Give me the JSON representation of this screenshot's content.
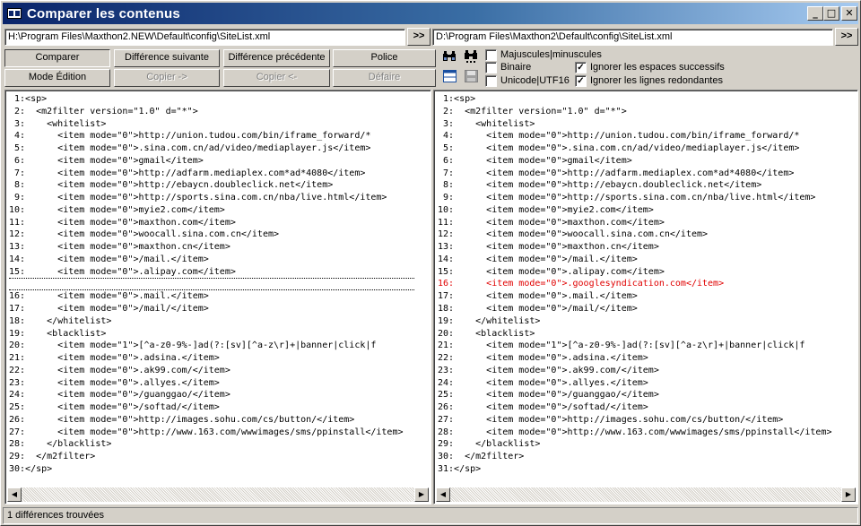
{
  "window": {
    "title": "Comparer les contenus",
    "buttons": {
      "minimize": "_",
      "maximize": "□",
      "close": "✕"
    }
  },
  "paths": {
    "left": "H:\\Program Files\\Maxthon2.NEW\\Default\\config\\SiteList.xml",
    "right": "D:\\Program Files\\Maxthon2\\Default\\config\\SiteList.xml",
    "browse_label": ">>"
  },
  "toolbar": {
    "compare": "Comparer",
    "next_diff": "Différence suivante",
    "prev_diff": "Différence précédente",
    "font": "Police",
    "edit_mode": "Mode Édition",
    "copy_right": "Copier ->",
    "copy_left": "Copier <-",
    "undo": "Défaire"
  },
  "options": {
    "case": {
      "label": "Majuscules|minuscules",
      "checked": false
    },
    "binary": {
      "label": "Binaire",
      "checked": false
    },
    "unicode": {
      "label": "Unicode|UTF16",
      "checked": false
    },
    "ignore_spaces": {
      "label": "Ignorer les espaces successifs",
      "checked": true
    },
    "ignore_lines": {
      "label": "Ignorer les lignes redondantes",
      "checked": true
    },
    "check_mark": "✓"
  },
  "left_lines": [
    " 1:<sp>",
    " 2:  <m2filter version=\"1.0\" d=\"*\">",
    " 3:    <whitelist>",
    " 4:      <item mode=\"0\">http://union.tudou.com/bin/iframe_forward/*",
    " 5:      <item mode=\"0\">.sina.com.cn/ad/video/mediaplayer.js</item>",
    " 6:      <item mode=\"0\">gmail</item>",
    " 7:      <item mode=\"0\">http://adfarm.mediaplex.com*ad*4080</item>",
    " 8:      <item mode=\"0\">http://ebaycn.doubleclick.net</item>",
    " 9:      <item mode=\"0\">http://sports.sina.com.cn/nba/live.html</item>",
    "10:      <item mode=\"0\">myie2.com</item>",
    "11:      <item mode=\"0\">maxthon.com</item>",
    "12:      <item mode=\"0\">woocall.sina.com.cn</item>",
    "13:      <item mode=\"0\">maxthon.cn</item>",
    "14:      <item mode=\"0\">/mail.</item>",
    "15:      <item mode=\"0\">.alipay.com</item>",
    "",
    "16:      <item mode=\"0\">.mail.</item>",
    "17:      <item mode=\"0\">/mail/</item>",
    "18:    </whitelist>",
    "19:    <blacklist>",
    "20:      <item mode=\"1\">[^a-z0-9%-]ad(?:[sv][^a-z\\r]+|banner|click|f",
    "21:      <item mode=\"0\">.adsina.</item>",
    "22:      <item mode=\"0\">.ak99.com/</item>",
    "23:      <item mode=\"0\">.allyes.</item>",
    "24:      <item mode=\"0\">/guanggao/</item>",
    "25:      <item mode=\"0\">/softad/</item>",
    "26:      <item mode=\"0\">http://images.sohu.com/cs/button/</item>",
    "27:      <item mode=\"0\">http://www.163.com/wwwimages/sms/ppinstall</item>",
    "28:    </blacklist>",
    "29:  </m2filter>",
    "30:</sp>"
  ],
  "right_lines": [
    " 1:<sp>",
    " 2:  <m2filter version=\"1.0\" d=\"*\">",
    " 3:    <whitelist>",
    " 4:      <item mode=\"0\">http://union.tudou.com/bin/iframe_forward/*",
    " 5:      <item mode=\"0\">.sina.com.cn/ad/video/mediaplayer.js</item>",
    " 6:      <item mode=\"0\">gmail</item>",
    " 7:      <item mode=\"0\">http://adfarm.mediaplex.com*ad*4080</item>",
    " 8:      <item mode=\"0\">http://ebaycn.doubleclick.net</item>",
    " 9:      <item mode=\"0\">http://sports.sina.com.cn/nba/live.html</item>",
    "10:      <item mode=\"0\">myie2.com</item>",
    "11:      <item mode=\"0\">maxthon.com</item>",
    "12:      <item mode=\"0\">woocall.sina.com.cn</item>",
    "13:      <item mode=\"0\">maxthon.cn</item>",
    "14:      <item mode=\"0\">/mail.</item>",
    "15:      <item mode=\"0\">.alipay.com</item>",
    "16:      <item mode=\"0\">.googlesyndication.com</item>",
    "17:      <item mode=\"0\">.mail.</item>",
    "18:      <item mode=\"0\">/mail/</item>",
    "19:    </whitelist>",
    "20:    <blacklist>",
    "21:      <item mode=\"1\">[^a-z0-9%-]ad(?:[sv][^a-z\\r]+|banner|click|f",
    "22:      <item mode=\"0\">.adsina.</item>",
    "23:      <item mode=\"0\">.ak99.com/</item>",
    "24:      <item mode=\"0\">.allyes.</item>",
    "25:      <item mode=\"0\">/guanggao/</item>",
    "26:      <item mode=\"0\">/softad/</item>",
    "27:      <item mode=\"0\">http://images.sohu.com/cs/button/</item>",
    "28:      <item mode=\"0\">http://www.163.com/wwwimages/sms/ppinstall</item>",
    "29:    </blacklist>",
    "30:  </m2filter>",
    "31:</sp>"
  ],
  "diff_color": "#e00000",
  "scroll": {
    "left_arrow": "◀",
    "right_arrow": "▶"
  },
  "status": "1 différences trouvées"
}
